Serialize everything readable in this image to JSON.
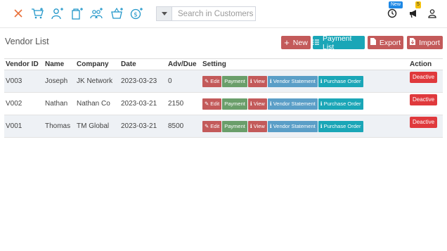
{
  "toolbar": {
    "icons": [
      "close-icon",
      "add-to-cart-icon",
      "add-user-icon",
      "add-product-icon",
      "add-group-icon",
      "basket-icon",
      "currency-icon"
    ],
    "search_dropdown_icon": "caret-down-icon",
    "search_placeholder": "Search in Customers",
    "right": {
      "clock_badge": "New",
      "notification_badge": "5",
      "icons": [
        "clock-icon",
        "megaphone-icon",
        "user-icon"
      ]
    }
  },
  "page": {
    "title": "Vendor List",
    "buttons": {
      "new": "New",
      "payment_list": "Payment List",
      "export": "Export",
      "import": "Import"
    }
  },
  "table": {
    "headers": [
      "Vendor ID",
      "Name",
      "Company",
      "Date",
      "Adv/Due",
      "Setting",
      "Action"
    ],
    "rows": [
      {
        "vendor_id": "V003",
        "name": "Joseph",
        "company": "JK Network",
        "date": "2023-03-23",
        "adv_due": "0"
      },
      {
        "vendor_id": "V002",
        "name": "Nathan",
        "company": "Nathan Co",
        "date": "2023-03-21",
        "adv_due": "2150"
      },
      {
        "vendor_id": "V001",
        "name": "Thomas",
        "company": "TM Global",
        "date": "2023-03-21",
        "adv_due": "8500"
      }
    ],
    "setting_labels": {
      "edit": "Edit",
      "payment": "Payment",
      "view": "View",
      "vendor_statement": "Vendor Statement",
      "purchase_order": "Purchase Order"
    },
    "action_label": "Deactive"
  },
  "colors": {
    "red_button": "#c35a5a",
    "teal_button": "#1aa6b7",
    "green_button": "#6a9e6a",
    "blue_button": "#5a9ec7",
    "deactive": "#e0393c",
    "toolbar_icon": "#2196c9",
    "striped_row": "#eef1f5"
  }
}
